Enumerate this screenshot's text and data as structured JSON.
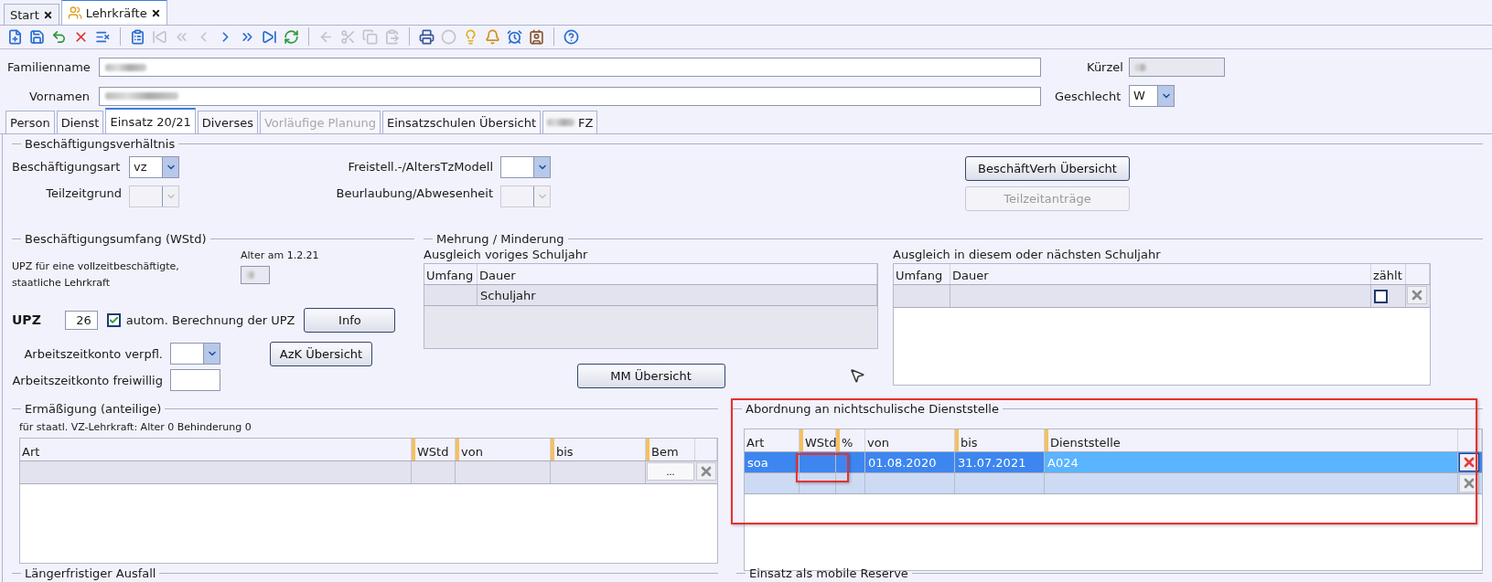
{
  "window_tabs": [
    {
      "label": "Start",
      "selected": false
    },
    {
      "label": "Lehrkräfte",
      "selected": true
    }
  ],
  "toolbar": [
    {
      "kind": "new",
      "disabled": false
    },
    {
      "kind": "save",
      "disabled": false
    },
    {
      "kind": "undo",
      "disabled": false
    },
    {
      "kind": "delete",
      "disabled": false
    },
    {
      "kind": "form-remove",
      "disabled": false
    },
    {
      "kind": "separator"
    },
    {
      "kind": "list",
      "disabled": false
    },
    {
      "kind": "first",
      "disabled": true
    },
    {
      "kind": "rewind",
      "disabled": true
    },
    {
      "kind": "prev",
      "disabled": true
    },
    {
      "kind": "next",
      "disabled": false
    },
    {
      "kind": "forward",
      "disabled": false
    },
    {
      "kind": "last",
      "disabled": false
    },
    {
      "kind": "refresh",
      "disabled": false
    },
    {
      "kind": "separator"
    },
    {
      "kind": "back",
      "disabled": true
    },
    {
      "kind": "cut",
      "disabled": true
    },
    {
      "kind": "copy",
      "disabled": true
    },
    {
      "kind": "paste",
      "disabled": true
    },
    {
      "kind": "separator"
    },
    {
      "kind": "print",
      "disabled": false
    },
    {
      "kind": "ellipse",
      "disabled": true
    },
    {
      "kind": "bulb",
      "disabled": false
    },
    {
      "kind": "bell",
      "disabled": false
    },
    {
      "kind": "clock",
      "disabled": false
    },
    {
      "kind": "card",
      "disabled": false
    },
    {
      "kind": "separator"
    },
    {
      "kind": "help",
      "disabled": false
    }
  ],
  "person": {
    "familienname_label": "Familienname",
    "vornamen_label": "Vornamen",
    "kuerzel_label": "Kürzel",
    "geschlecht_label": "Geschlecht",
    "geschlecht_value": "W"
  },
  "tabs": [
    {
      "label": "Person",
      "selected": false,
      "disabled": false
    },
    {
      "label": "Dienst",
      "selected": false,
      "disabled": false
    },
    {
      "label": "Einsatz 20/21",
      "selected": true,
      "disabled": false
    },
    {
      "label": "Diverses",
      "selected": false,
      "disabled": false
    },
    {
      "label": "Vorläufige Planung",
      "selected": false,
      "disabled": true
    },
    {
      "label": "Einsatzschulen Übersicht",
      "selected": false,
      "disabled": false
    },
    {
      "label": "FZ",
      "selected": false,
      "disabled": false
    }
  ],
  "beschaeftigungsverhaeltnis": {
    "title": "Beschäftigungsverhältnis",
    "fields": [
      {
        "label": "Beschäftigungsart",
        "value": "vz",
        "disabled": false
      },
      {
        "label": "Teilzeitgrund",
        "disabled": true
      },
      {
        "label": "Freistell.-/AltersTzModell",
        "disabled": false
      },
      {
        "label": "Beurlaubung/Abwesenheit",
        "disabled": true
      }
    ],
    "buttons": [
      {
        "label": "BeschäftVerh Übersicht",
        "disabled": false
      },
      {
        "label": "Teilzeitanträge",
        "disabled": true
      }
    ]
  },
  "beschaeftigungsumfang": {
    "title": "Beschäftigungsumfang (WStd)",
    "note": "UPZ für eine vollzeitbeschäftigte, staatliche Lehrkraft",
    "alter_label": "Alter am 1.2.21",
    "upz_label": "UPZ",
    "upz_value": "26",
    "auto_checkbox": {
      "label": "autom. Berechnung der UPZ",
      "checked": true
    },
    "info_button": "Info",
    "azk_verpfl_label": "Arbeitszeitkonto verpfl.",
    "azk_button": "AzK Übersicht",
    "azk_freiwillig_label": "Arbeitszeitkonto freiwillig"
  },
  "mehrung_minderung": {
    "title": "Mehrung / Minderung",
    "voriges": {
      "title": "Ausgleich voriges Schuljahr",
      "columns": [
        "Umfang",
        "Dauer"
      ],
      "rows": [
        [
          "",
          "Schuljahr"
        ]
      ]
    },
    "diesem": {
      "title": "Ausgleich in diesem oder nächsten Schuljahr",
      "columns": [
        "Umfang",
        "Dauer",
        "zählt"
      ],
      "rows": [
        {
          "cells": [
            "",
            ""
          ],
          "checked": false
        }
      ]
    },
    "button": "MM Übersicht"
  },
  "ermaessigung": {
    "title": "Ermäßigung (anteilige)",
    "note": "für staatl. VZ-Lehrkraft: Alter 0 Behinderung 0",
    "columns": [
      "Art",
      "WStd",
      "von",
      "bis",
      "Bem"
    ],
    "rows": [
      {
        "cells": [
          "",
          "",
          "",
          ""
        ],
        "button": "..."
      }
    ]
  },
  "abordnung": {
    "title": "Abordnung an nichtschulische Dienststelle",
    "columns": [
      "Art",
      "WStd",
      "%",
      "von",
      "bis",
      "Dienststelle"
    ],
    "rows": [
      {
        "cells": [
          "soa",
          "",
          "",
          "01.08.2020",
          "31.07.2021",
          "A024"
        ],
        "selected": true
      },
      {
        "cells": [
          "",
          "",
          "",
          "",
          "",
          ""
        ],
        "selected": false
      }
    ]
  },
  "bottom_sections": [
    "Längerfristiger Ausfall",
    "Einsatz als mobile Reserve"
  ]
}
